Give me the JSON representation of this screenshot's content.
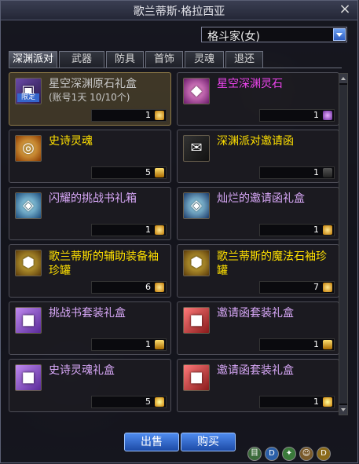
{
  "window": {
    "title": "歌兰蒂斯·格拉西亚",
    "close_icon": "×"
  },
  "character_select": {
    "value": "格斗家(女)"
  },
  "tabs": [
    "深渊派对",
    "武器",
    "防具",
    "首饰",
    "灵魂",
    "退还"
  ],
  "items": [
    {
      "name": "星空深渊原石礼盒",
      "sub": "(账号1天 10/10个)",
      "price": "1",
      "color": "#c8c8c8",
      "tag": "限定",
      "currency": "coin-icon",
      "icon": "gift-box-icon",
      "selected": true
    },
    {
      "name": "星空深渊灵石",
      "sub": "",
      "price": "1",
      "color": "#ee44ee",
      "tag": "",
      "currency": "purple-stone-icon",
      "icon": "spirit-stone-icon",
      "selected": false
    },
    {
      "name": "史诗灵魂",
      "sub": "",
      "price": "5",
      "color": "#ffe000",
      "tag": "",
      "currency": "gold-box-icon",
      "icon": "epic-soul-icon",
      "selected": false
    },
    {
      "name": "深渊派对邀请函",
      "sub": "",
      "price": "1",
      "color": "#ffe000",
      "tag": "",
      "currency": "invitation-icon",
      "icon": "invitation-letter-icon",
      "selected": false
    },
    {
      "name": "闪耀的挑战书礼箱",
      "sub": "",
      "price": "1",
      "color": "#d8a8f8",
      "tag": "",
      "currency": "coin-icon",
      "icon": "shining-chest-icon",
      "selected": false
    },
    {
      "name": "灿烂的邀请函礼盒",
      "sub": "",
      "price": "1",
      "color": "#d8a8f8",
      "tag": "",
      "currency": "coin-icon",
      "icon": "brilliant-chest-icon",
      "selected": false
    },
    {
      "name": "歌兰蒂斯的辅助装备袖珍罐",
      "sub": "",
      "price": "6",
      "color": "#ffe000",
      "tag": "",
      "currency": "coin-icon",
      "icon": "pocket-jar-icon",
      "selected": false
    },
    {
      "name": "歌兰蒂斯的魔法石袖珍罐",
      "sub": "",
      "price": "7",
      "color": "#ffe000",
      "tag": "",
      "currency": "coin-icon",
      "icon": "pocket-jar-icon",
      "selected": false
    },
    {
      "name": "挑战书套装礼盒",
      "sub": "",
      "price": "1",
      "color": "#d8a8f8",
      "tag": "",
      "currency": "gold-box-icon",
      "icon": "purple-gift-box-icon",
      "selected": false
    },
    {
      "name": "邀请函套装礼盒",
      "sub": "",
      "price": "1",
      "color": "#d8a8f8",
      "tag": "",
      "currency": "gold-box-icon",
      "icon": "red-gift-box-icon",
      "selected": false
    },
    {
      "name": "史诗灵魂礼盒",
      "sub": "",
      "price": "5",
      "color": "#d8a8f8",
      "tag": "",
      "currency": "star-icon",
      "icon": "purple-gift-box-icon",
      "selected": false
    },
    {
      "name": "邀请函套装礼盒",
      "sub": "",
      "price": "1",
      "color": "#d8a8f8",
      "tag": "",
      "currency": "star-icon",
      "icon": "red-gift-box-icon",
      "selected": false
    }
  ],
  "buttons": {
    "sell": "出售",
    "buy": "购买"
  },
  "taskbar": [
    "目",
    "D",
    "✦",
    "☺",
    "D"
  ]
}
